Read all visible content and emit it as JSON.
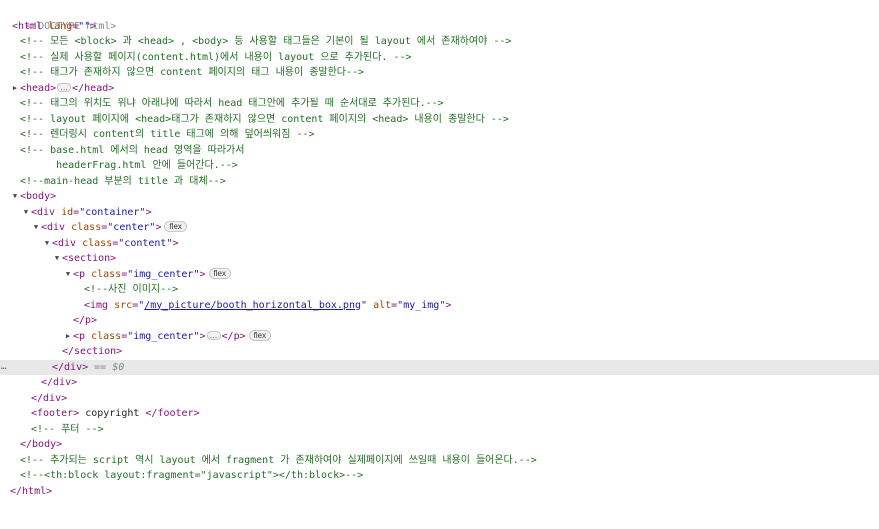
{
  "doctype": "<!DOCTYPE html>",
  "html_lang": "ko",
  "comments": {
    "c1": "<!-- 모든 <block> 과 <head> , <body> 등 사용할 태그들은 기본이 될 layout 에서 존재하여야 -->",
    "c2": "<!-- 실제 사용할 페이지(content.html)에서 내용이 layout 으로 추가된다. -->",
    "c3": "<!-- 태그가 존재하지 않으면 content 페이지의 태그 내용이 종말한다-->",
    "c4": "<!-- 태그의 위치도 위냐 아래냐에 따라서 head 태그안에 추가될 때 순서대로 추가된다.-->",
    "c5": "<!-- layout 페이지에 <head>태그가 존재하지 않으면 content 페이지의 <head> 내용이 종말한다 -->",
    "c6": "<!-- 렌더링시 content의 title 태그에 의해 덮어씌워짐 -->",
    "c7a": "<!-- base.html 에서의 head 영역을 따라가서",
    "c7b": "      headerFrag.html 안에 들어간다.-->",
    "c8": "<!--main-head 부분의 title 과 대체-->",
    "c9": "<!--사진 이미지-->",
    "c10": "<!-- 푸터 -->",
    "c11": "<!-- 추가되는 script 역시 layout 에서 fragment 가 존재하여야 실제페이지에 쓰일때 내용이 들어온다.-->",
    "c12": "<!--<th:block layout:fragment=\"javascript\"></th:block>-->"
  },
  "attrs": {
    "container_id": "container",
    "center_class": "center",
    "content_class": "content",
    "img_center_class": "img_center",
    "img_src": "/my_picture/booth_horizontal_box.png",
    "img_alt": "my_img"
  },
  "badges": {
    "flex": "flex"
  },
  "ellipsis": "…",
  "footer_text": " copyright ",
  "selected_suffix": " == $0",
  "gutter": "…",
  "colors": {
    "tag": "#881280",
    "attr_name": "#994500",
    "attr_value": "#1a1aa6",
    "comment": "#236e25",
    "selected_row": "#e8e8e8"
  }
}
